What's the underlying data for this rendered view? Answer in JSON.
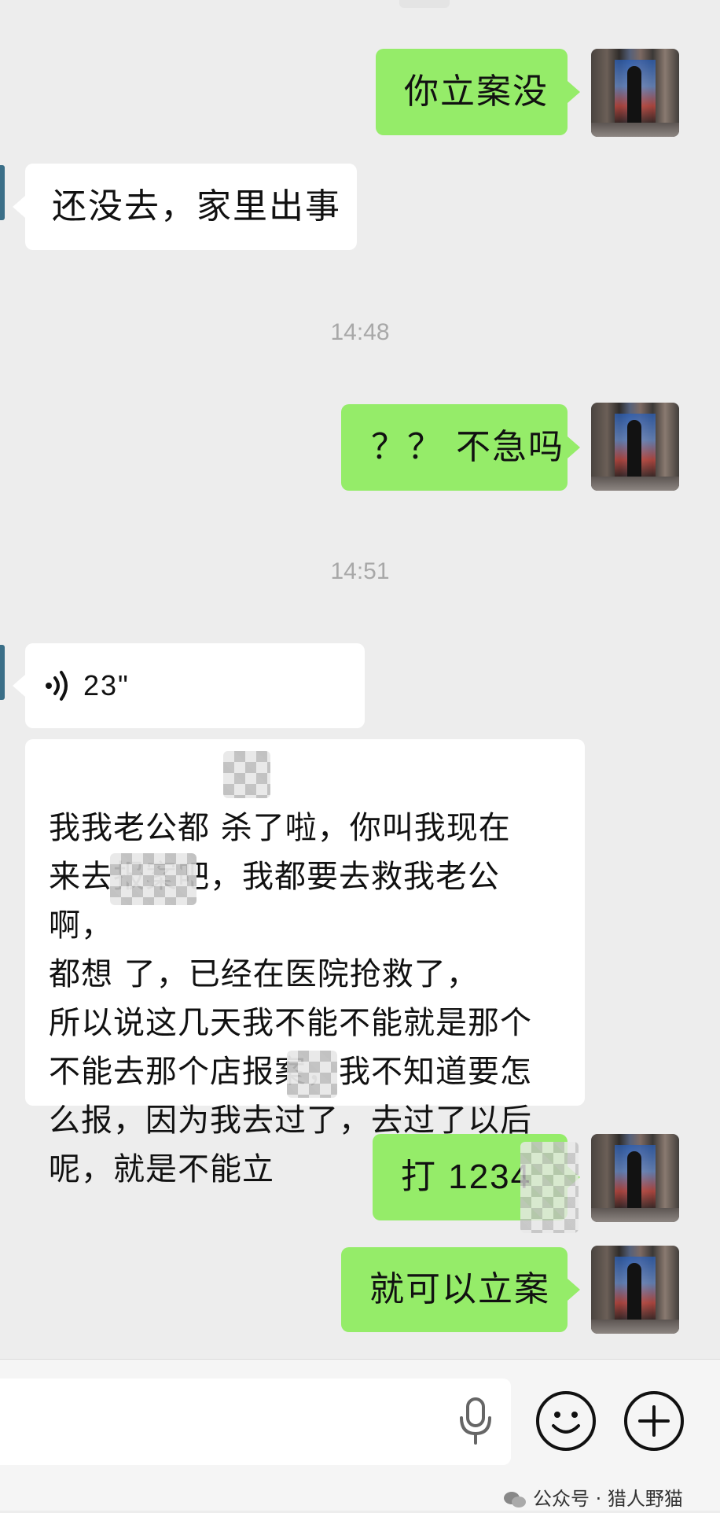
{
  "messages": {
    "m1": "你立案没",
    "m2": "还没去，家里出事",
    "t1": "14:48",
    "m3": "？？ 不急吗",
    "t2": "14:51",
    "voice_duration": "23\"",
    "long_message": "我我老公都  杀了啦，你叫我现在\n来去报案吧，我都要去救我老公啊，\n都想      了，已经在医院抢救了，\n所以说这几天我不能不能就是那个\n不能去那个店报案，我不知道要怎\n么报，因为我去过了，去过了以后\n呢，就是不能立",
    "m5": "打 1234",
    "m6": "就可以立案"
  },
  "watermark": {
    "label": "公众号 · 猎人野猫"
  },
  "icons": {
    "voice": "voice-wave-icon",
    "mic": "microphone-icon",
    "emoji": "smiley-icon",
    "plus": "plus-icon"
  },
  "colors": {
    "self_bubble": "#95ec69",
    "other_bubble": "#ffffff",
    "background": "#ededed"
  }
}
